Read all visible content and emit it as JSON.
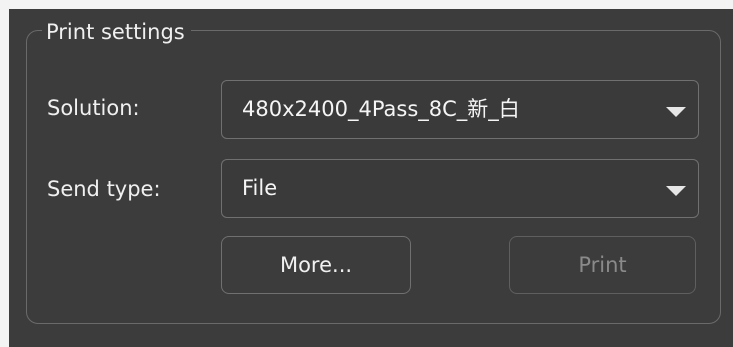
{
  "print_settings": {
    "group_title": "Print settings",
    "solution_label": "Solution:",
    "solution_value": "480x2400_4Pass_8C_新_白",
    "send_type_label": "Send type:",
    "send_type_value": "File",
    "more_button_label": "More...",
    "print_button_label": "Print",
    "print_button_enabled": false
  },
  "icons": {
    "dropdown_arrow": "chevron-down-icon"
  },
  "colors": {
    "panel_background": "#3c3c3c",
    "text": "#f0f0f0",
    "disabled_text": "#8a8a8a",
    "border": "#707070"
  }
}
